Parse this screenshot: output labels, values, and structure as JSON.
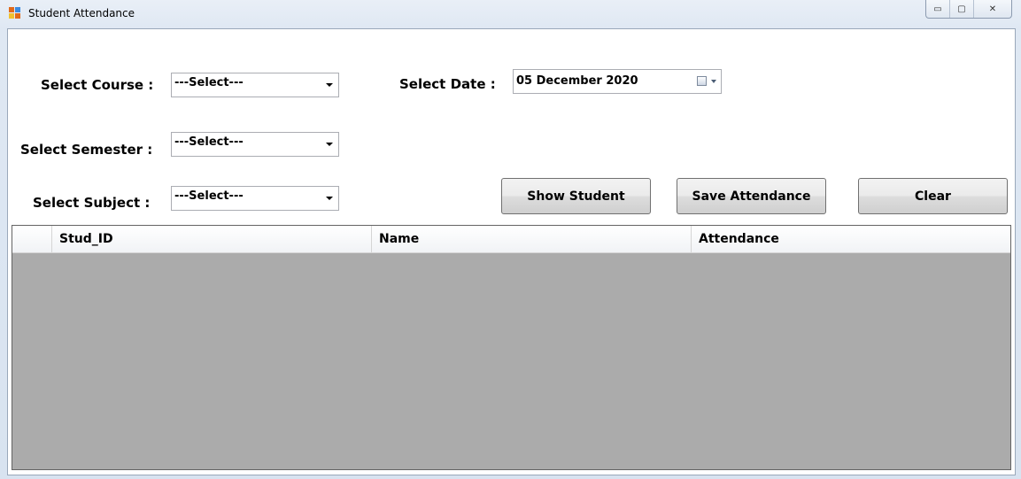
{
  "window": {
    "title": "Student Attendance",
    "controls": {
      "minimize": "▭",
      "maximize": "▢",
      "close": "✕"
    }
  },
  "form": {
    "course": {
      "label": "Select Course :",
      "value": "---Select---"
    },
    "date": {
      "label": "Select Date :",
      "value": "05  December  2020"
    },
    "semester": {
      "label": "Select Semester :",
      "value": "---Select---"
    },
    "subject": {
      "label": "Select Subject  :",
      "value": "---Select---"
    }
  },
  "buttons": {
    "show_student": "Show Student",
    "save_attendance": "Save Attendance",
    "clear": "Clear"
  },
  "grid": {
    "columns": [
      "Stud_ID",
      "Name",
      "Attendance"
    ],
    "rows": []
  }
}
